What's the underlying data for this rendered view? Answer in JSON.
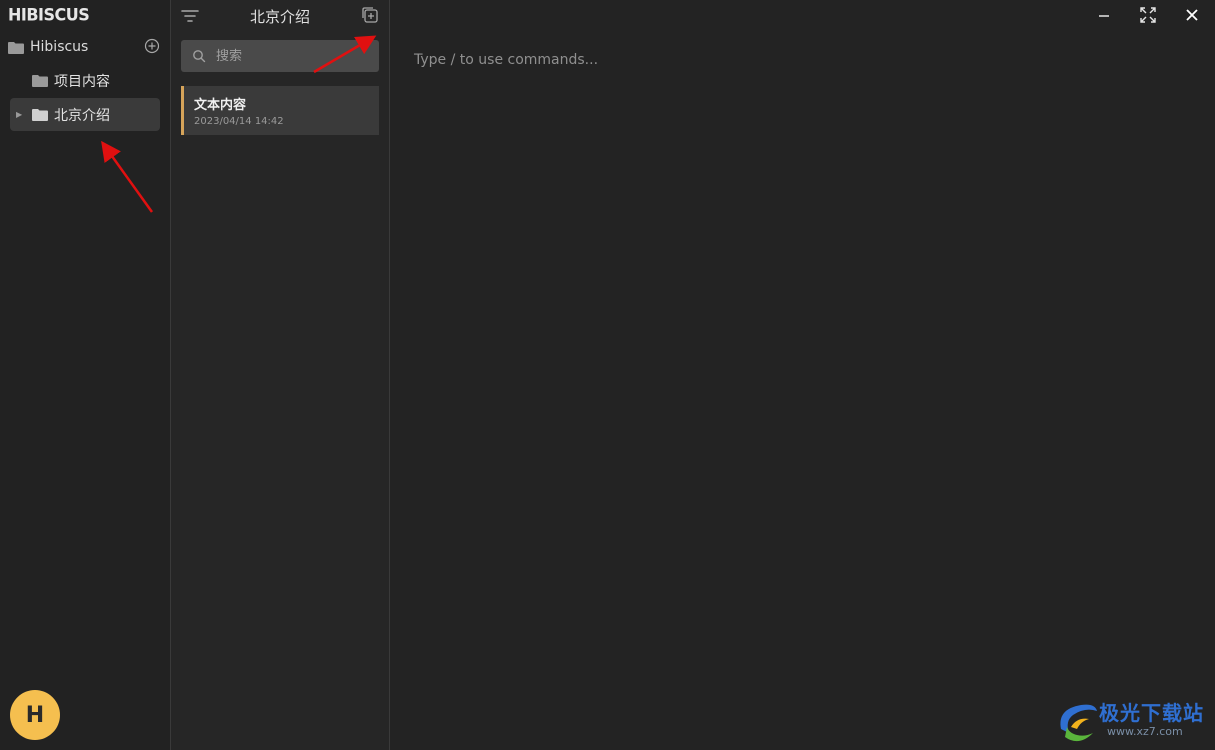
{
  "sidebar": {
    "logo": "HIBISCUS",
    "workspace_label": "Hibiscus",
    "items": [
      {
        "label": "项目内容"
      },
      {
        "label": "北京介绍"
      }
    ],
    "avatar_letter": "H"
  },
  "notelist": {
    "title": "北京介绍",
    "search_placeholder": "搜索",
    "notes": [
      {
        "title": "文本内容",
        "date": "2023/04/14 14:42"
      }
    ]
  },
  "editor": {
    "placeholder": "Type / to use commands..."
  },
  "watermark": {
    "text": "极光下载站",
    "url": "www.xz7.com"
  },
  "colors": {
    "accent": "#d6a45a",
    "avatar": "#f5bf4f",
    "annotation": "#e01010"
  }
}
